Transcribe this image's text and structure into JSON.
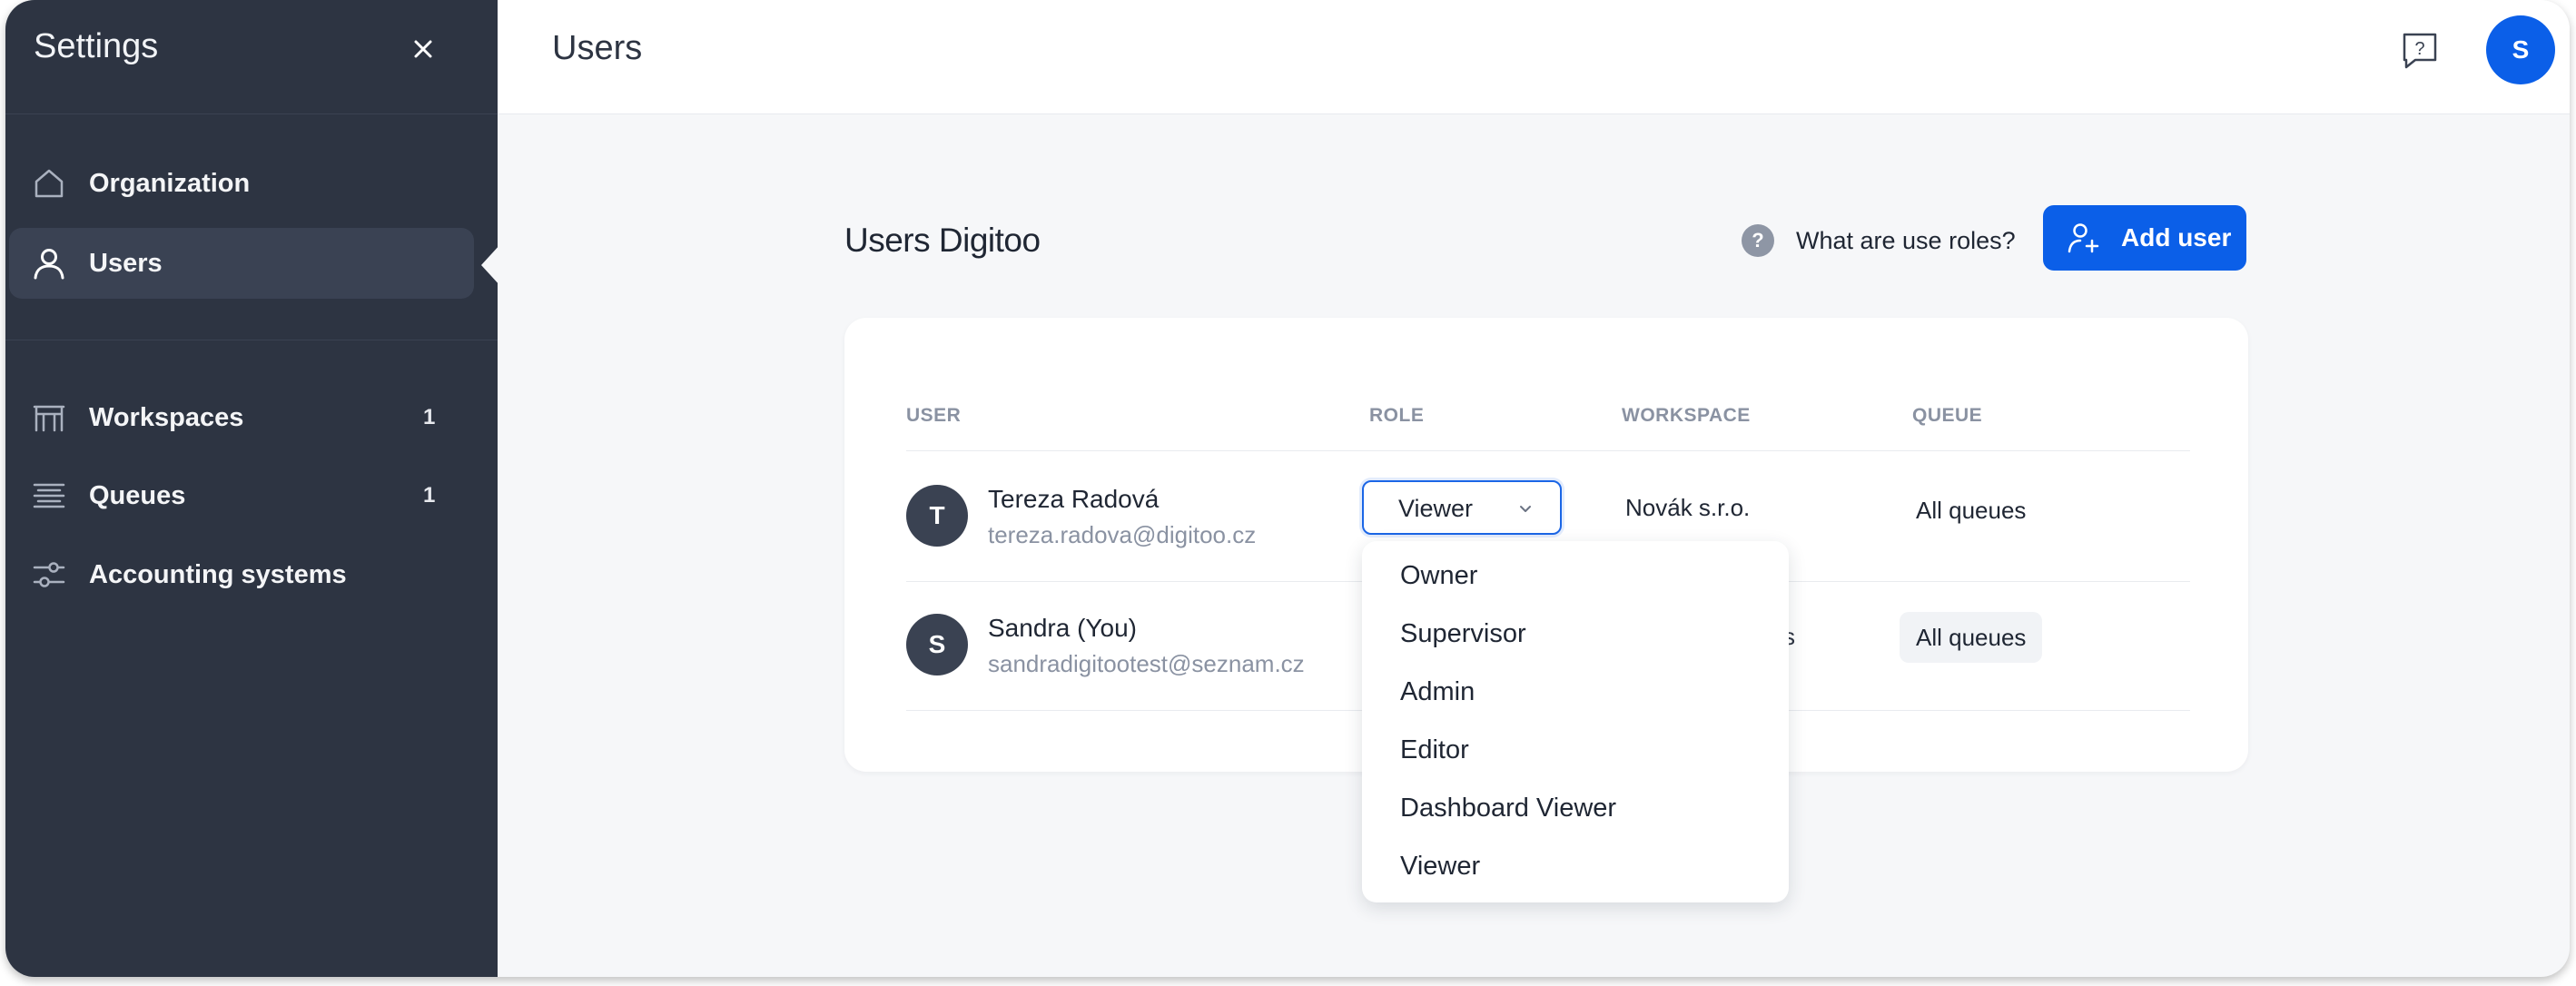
{
  "sidebar": {
    "title": "Settings",
    "items": [
      {
        "label": "Organization",
        "icon": "home-icon"
      },
      {
        "label": "Users",
        "icon": "user-icon"
      },
      {
        "label": "Workspaces",
        "icon": "workspace-icon",
        "count": "1"
      },
      {
        "label": "Queues",
        "icon": "queues-icon",
        "count": "1"
      },
      {
        "label": "Accounting systems",
        "icon": "sliders-icon"
      }
    ]
  },
  "header": {
    "title": "Users",
    "avatar_initial": "S"
  },
  "content": {
    "title": "Users Digitoo",
    "roles_link": "What are use roles?",
    "help_glyph": "?",
    "add_user_label": "Add user"
  },
  "table": {
    "columns": [
      "USER",
      "ROLE",
      "WORKSPACE",
      "QUEUE"
    ],
    "rows": [
      {
        "initial": "T",
        "name": "Tereza Radová",
        "email": "tereza.radova@digitoo.cz",
        "role": "Viewer",
        "workspace": "Novák s.r.o.",
        "queue": "All queues"
      },
      {
        "initial": "S",
        "name": "Sandra (You)",
        "email": "sandradigitootest@seznam.cz",
        "role": "",
        "workspace": "",
        "queue": "All queues"
      }
    ]
  },
  "role_dropdown": {
    "options": [
      "Owner",
      "Supervisor",
      "Admin",
      "Editor",
      "Dashboard Viewer",
      "Viewer"
    ]
  },
  "colors": {
    "sidebar_bg": "#2d3442",
    "accent": "#0b5fe8",
    "page_bg": "#f6f7f9"
  }
}
